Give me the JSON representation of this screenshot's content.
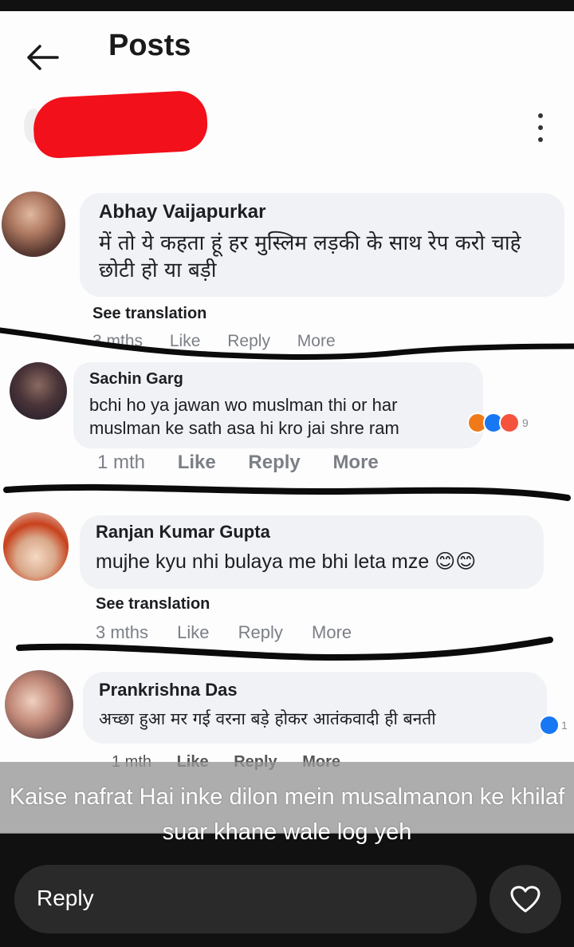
{
  "header": {
    "title": "Posts"
  },
  "comments": [
    {
      "author": "Abhay Vaijapurkar",
      "text": "में तो ये कहता हूं हर मुस्लिम लड़की के साथ रेप करो चाहे छोटी हो या बड़ी",
      "see_translation": "See translation",
      "time": "3 mths",
      "like": "Like",
      "reply": "Reply",
      "more": "More"
    },
    {
      "author": "Sachin Garg",
      "text": "bchi ho ya jawan wo muslman thi or har muslman ke sath asa hi kro jai shre ram",
      "time": "1 mth",
      "like": "Like",
      "reply": "Reply",
      "more": "More",
      "reaction_count": "9"
    },
    {
      "author": "Ranjan Kumar Gupta",
      "text": "mujhe kyu nhi bulaya me bhi leta mze 😊😊",
      "see_translation": "See translation",
      "time": "3 mths",
      "like": "Like",
      "reply": "Reply",
      "more": "More"
    },
    {
      "author": "Prankrishna Das",
      "text": "अच्छा हुआ मर गई वरना बड़े होकर आतंकवादी ही बनती",
      "time": "1 mth",
      "like": "Like",
      "reply": "Reply",
      "more": "More",
      "reaction_count": "1"
    }
  ],
  "overlay_caption": "Kaise nafrat Hai inke dilon mein musalmanon ke khilaf suar khane wale log yeh",
  "reply_bar": {
    "label": "Reply"
  },
  "colors": {
    "redaction": "#f2101b",
    "bubble": "#f0f2f5",
    "like_blue": "#1877f2",
    "angry": "#f07a1a"
  }
}
